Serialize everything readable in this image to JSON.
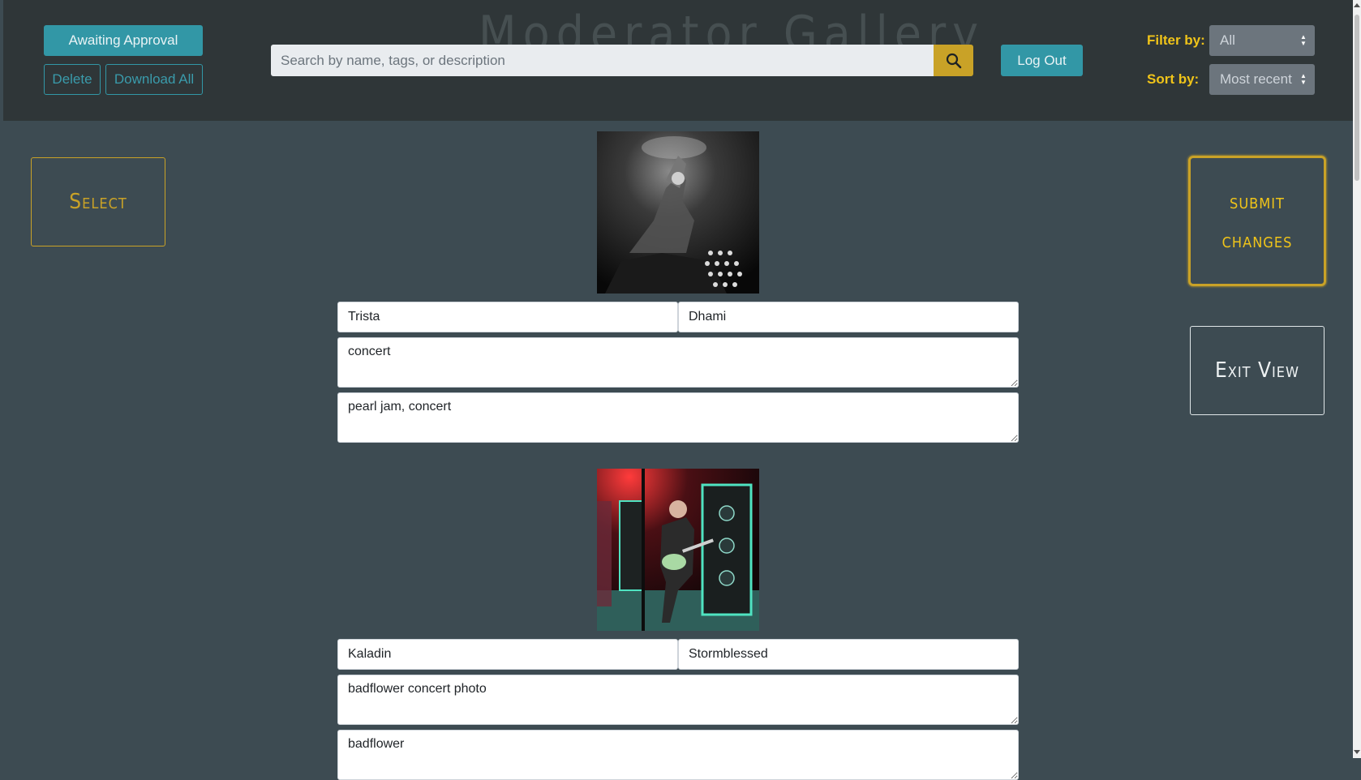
{
  "header": {
    "title": "Moderator Gallery",
    "awaiting_label": "Awaiting Approval",
    "delete_label": "Delete",
    "download_all_label": "Download All",
    "search_placeholder": "Search by name, tags, or description",
    "search_icon": "search-icon",
    "logout_label": "Log Out",
    "filter_label": "Filter by:",
    "filter_value": "All",
    "sort_label": "Sort by:",
    "sort_value": "Most recent"
  },
  "side": {
    "select_label": "Select",
    "submit_line1": "submit",
    "submit_line2": "changes",
    "exit_label": "Exit View"
  },
  "colors": {
    "header_bg": "#2f3638",
    "page_bg": "#3d4b52",
    "accent_teal": "#3297a6",
    "accent_gold": "#c9a227",
    "label_yellow": "#f0c419"
  },
  "cards": [
    {
      "image_alt": "black and white concert photo",
      "first_name": "Trista",
      "last_name": "Dhami",
      "description": "concert",
      "tags": "pearl jam, concert"
    },
    {
      "image_alt": "badflower concert color photo",
      "first_name": "Kaladin",
      "last_name": "Stormblessed",
      "description": "badflower concert photo",
      "tags": "badflower"
    }
  ]
}
